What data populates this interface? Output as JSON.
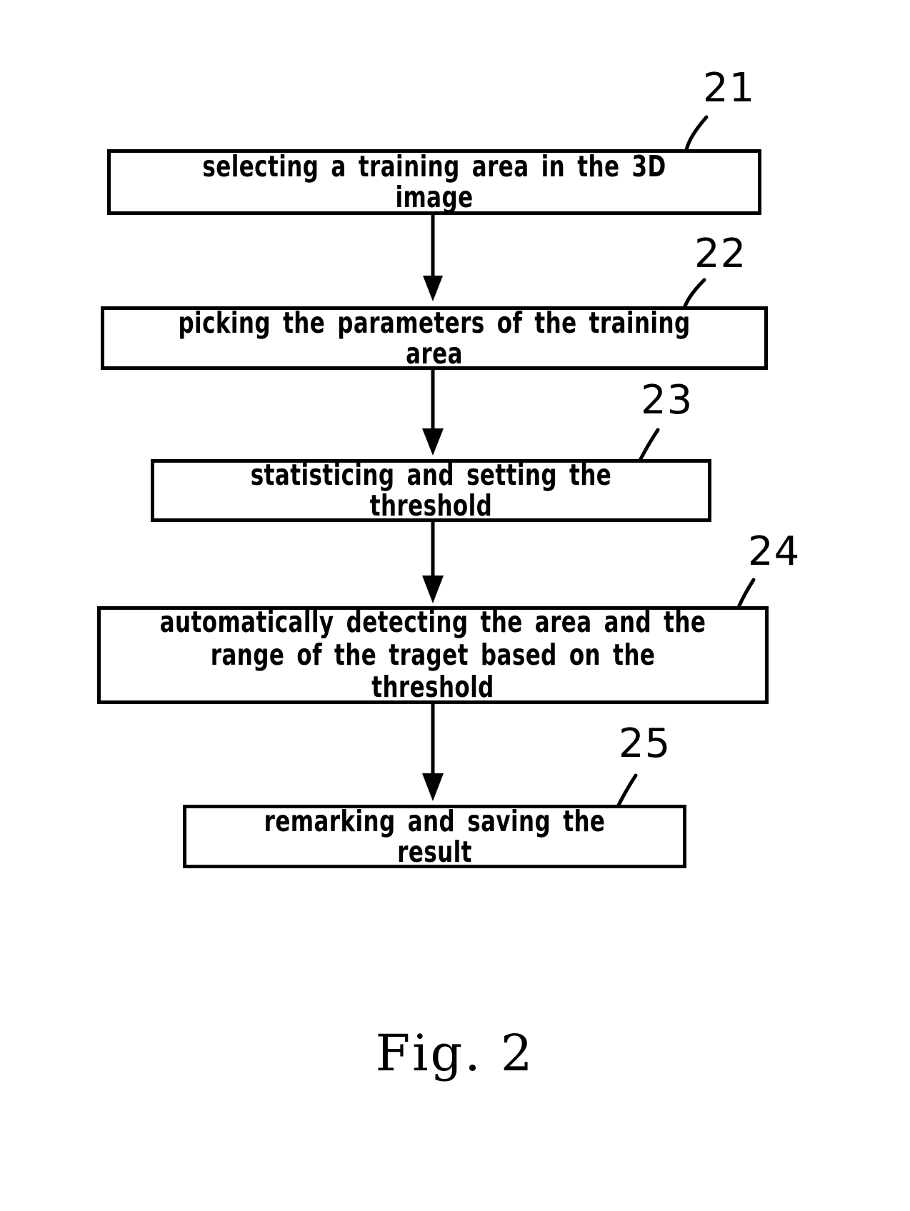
{
  "figure": {
    "caption": "Fig.  2",
    "type": "patent-flowchart",
    "ink_color": "#000000",
    "background_color": "#ffffff"
  },
  "flowchart": {
    "steps": [
      {
        "ref": "21",
        "text": "selecting  a  training  area  in  the  3D  image"
      },
      {
        "ref": "22",
        "text": "picking  the  parameters  of  the  training  area"
      },
      {
        "ref": "23",
        "text": "statisticing  and  setting  the  threshold"
      },
      {
        "ref": "24",
        "text": "automatically  detecting  the  area  and  the\nrange  of  the  traget  based  on  the  threshold"
      },
      {
        "ref": "25",
        "text": "remarking  and  saving  the  result"
      }
    ],
    "connector_count": 4,
    "connector_style": "downward-arrow"
  }
}
